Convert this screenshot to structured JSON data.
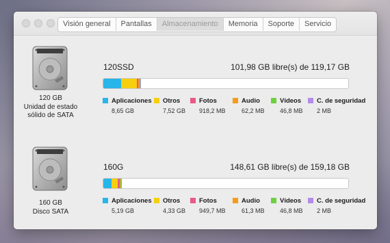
{
  "window": {
    "tabs": [
      {
        "label": "Visión general",
        "active": false
      },
      {
        "label": "Pantallas",
        "active": false
      },
      {
        "label": "Almacenamiento",
        "active": true
      },
      {
        "label": "Memoria",
        "active": false
      },
      {
        "label": "Soporte",
        "active": false
      },
      {
        "label": "Servicio",
        "active": false
      }
    ]
  },
  "colors": {
    "Aplicaciones": "#28b5e9",
    "Otros": "#f6cf0f",
    "Fotos": "#e85a86",
    "Audio": "#f59b1a",
    "Vídeos": "#6cd13f",
    "C. de seguridad": "#b28ce9"
  },
  "drives": [
    {
      "name": "120SSD",
      "capacity_text": "101,98 GB libre(s) de 119,17 GB",
      "size_label": "120 GB",
      "type_line1": "Unidad de estado",
      "type_line2": "sólido de SATA",
      "total_gb": 119.17,
      "usage": [
        {
          "category": "Aplicaciones",
          "size": "8,65 GB",
          "gb": 8.65
        },
        {
          "category": "Otros",
          "size": "7,52 GB",
          "gb": 7.52
        },
        {
          "category": "Fotos",
          "size": "918,2 MB",
          "gb": 0.918
        },
        {
          "category": "Audio",
          "size": "62,2 MB",
          "gb": 0.062
        },
        {
          "category": "Vídeos",
          "size": "46,8 MB",
          "gb": 0.047
        },
        {
          "category": "C. de seguridad",
          "size": "2 MB",
          "gb": 0.002
        }
      ]
    },
    {
      "name": "160G",
      "capacity_text": "148,61 GB libre(s) de 159,18 GB",
      "size_label": "160 GB",
      "type_line1": "Disco SATA",
      "type_line2": "",
      "total_gb": 159.18,
      "usage": [
        {
          "category": "Aplicaciones",
          "size": "5,19 GB",
          "gb": 5.19
        },
        {
          "category": "Otros",
          "size": "4,33 GB",
          "gb": 4.33
        },
        {
          "category": "Fotos",
          "size": "949,7 MB",
          "gb": 0.95
        },
        {
          "category": "Audio",
          "size": "61,3 MB",
          "gb": 0.061
        },
        {
          "category": "Vídeos",
          "size": "46,8 MB",
          "gb": 0.047
        },
        {
          "category": "C. de seguridad",
          "size": "2 MB",
          "gb": 0.002
        }
      ]
    }
  ]
}
